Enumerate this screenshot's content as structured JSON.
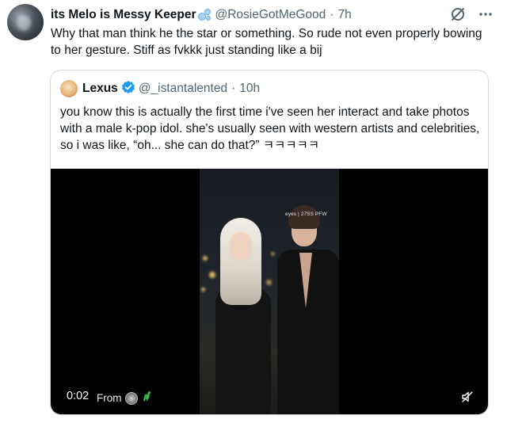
{
  "tweet": {
    "display_name": "its Melo is Messy Keeper",
    "name_icon": "bubbles-emoji",
    "handle": "@RosieGotMeGood",
    "separator": "·",
    "time": "7h",
    "text": "Why that man think he the star or something. So rude not even properly bowing to her gesture. Stiff as fvkkk just standing like a bij",
    "action_icons": [
      "grok-icon",
      "more-icon"
    ]
  },
  "quote": {
    "display_name": "Lexus",
    "verified": true,
    "handle": "@_istantalented",
    "separator": "·",
    "time": "10h",
    "text": "you know this is actually the first time i've seen her interact and take photos with a male k-pop idol. she's usually seen with western artists and celebrities, so i was like, “oh... she can do that?” ㅋㅋㅋㅋㅋ",
    "media": {
      "type": "video",
      "timestamp": "0:02",
      "from_label": "From",
      "watermark": "eyes | 27SS PFW",
      "control_icons": [
        "mute-icon"
      ]
    }
  },
  "colors": {
    "text_primary": "#0f1419",
    "text_secondary": "#536471",
    "verified_blue": "#1d9bf0",
    "border": "#cfd9de",
    "media_bg": "#000000"
  }
}
